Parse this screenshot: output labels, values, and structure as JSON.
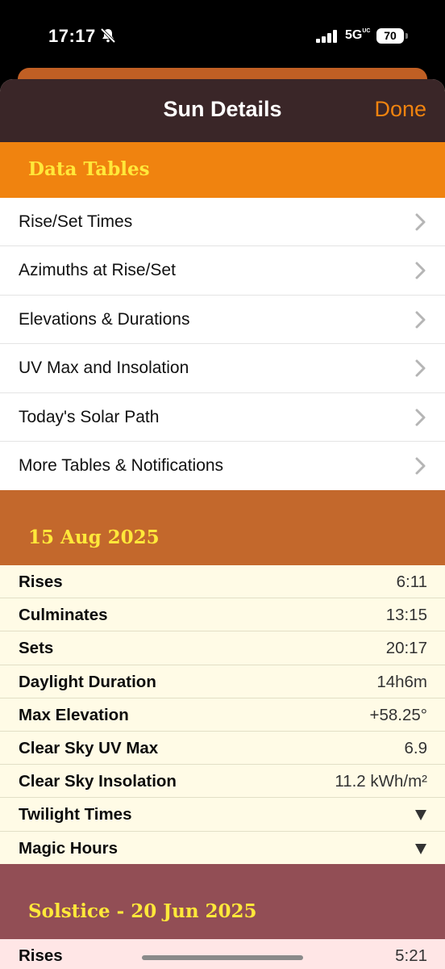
{
  "status": {
    "time": "17:17",
    "network": "5G",
    "network_sub": "UC",
    "battery": "70"
  },
  "nav": {
    "title": "Sun Details",
    "done_label": "Done"
  },
  "data_tables": {
    "title": "Data Tables",
    "items": [
      {
        "label": "Rise/Set Times"
      },
      {
        "label": "Azimuths at Rise/Set"
      },
      {
        "label": "Elevations & Durations"
      },
      {
        "label": "UV Max and Insolation"
      },
      {
        "label": "Today's Solar Path"
      },
      {
        "label": "More Tables & Notifications"
      }
    ]
  },
  "today": {
    "title": "15 Aug 2025",
    "rows": [
      {
        "label": "Rises",
        "value": "6:11"
      },
      {
        "label": "Culminates",
        "value": "13:15"
      },
      {
        "label": "Sets",
        "value": "20:17"
      },
      {
        "label": "Daylight Duration",
        "value": "14h6m"
      },
      {
        "label": "Max Elevation",
        "value": "+58.25°"
      },
      {
        "label": "Clear Sky UV Max",
        "value": "6.9"
      },
      {
        "label": "Clear Sky Insolation",
        "value": "11.2 kWh/m²"
      },
      {
        "label": "Twilight Times"
      },
      {
        "label": "Magic Hours"
      }
    ]
  },
  "solstice": {
    "title": "Solstice - 20 Jun 2025",
    "rows": [
      {
        "label": "Rises",
        "value": "5:21"
      }
    ]
  },
  "colors": {
    "nav_bg": "#3a2628",
    "accent": "#f0830f",
    "data_tables_header": "#f0830f",
    "today_header": "#c3682c",
    "solstice_header": "#924e55",
    "header_text": "#ffe83a",
    "today_rows_bg": "#fffbe6",
    "solstice_rows_bg": "#ffe6e6"
  }
}
